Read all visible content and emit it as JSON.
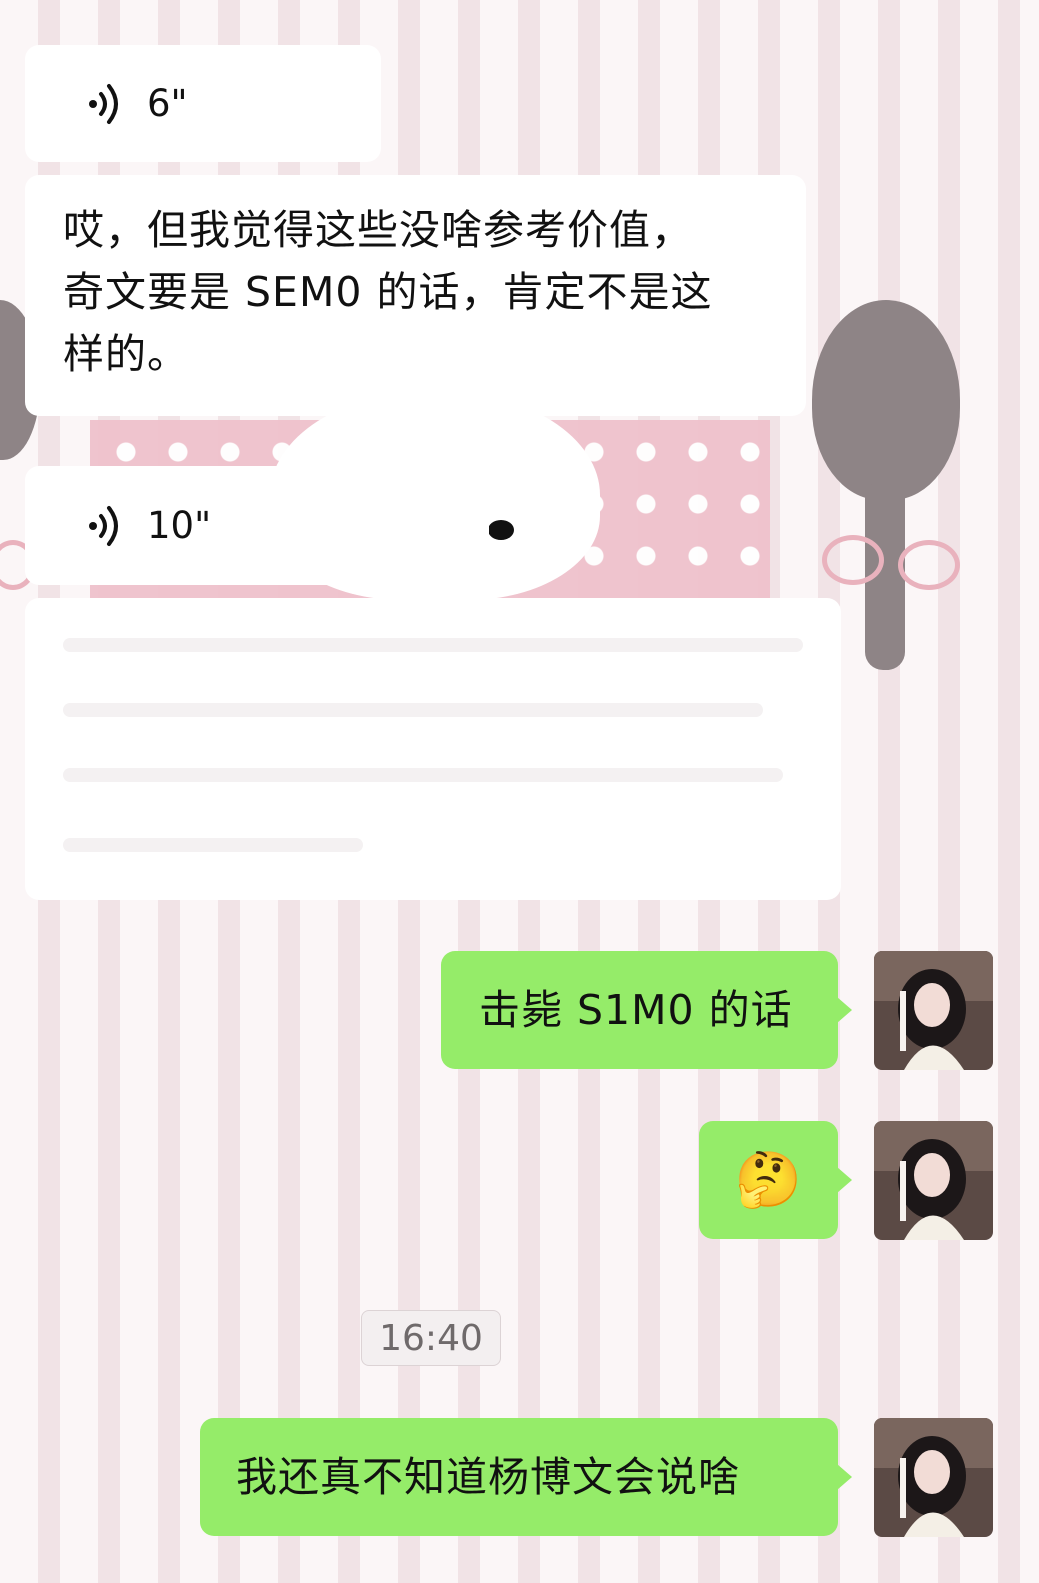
{
  "messages": [
    {
      "type": "voice",
      "side": "left",
      "duration": "6\""
    },
    {
      "type": "text",
      "side": "left",
      "lines": [
        "哎，但我觉得这些没啥参考价值，",
        "奇文要是 SEM0 的话，肯定不是这",
        "样的。"
      ]
    },
    {
      "type": "voice",
      "side": "left",
      "duration": "10\""
    },
    {
      "type": "text",
      "side": "left",
      "lines": [],
      "note": ""
    },
    {
      "type": "text",
      "side": "right",
      "text": "击毙 S1M0 的话"
    },
    {
      "type": "emoji",
      "side": "right",
      "emoji": "🤔",
      "icon": "thinking-face-emoji"
    },
    {
      "type": "text",
      "side": "right",
      "text": "我还真不知道杨博文会说啥"
    }
  ],
  "timestamp": "16:40",
  "colors": {
    "incoming_bubble": "#ffffff",
    "outgoing_bubble": "#95ec69",
    "text": "#111111",
    "timestamp_text": "#6f6a6b"
  },
  "icons": {
    "voice": "voice-wave-icon",
    "avatar": "user-avatar"
  }
}
